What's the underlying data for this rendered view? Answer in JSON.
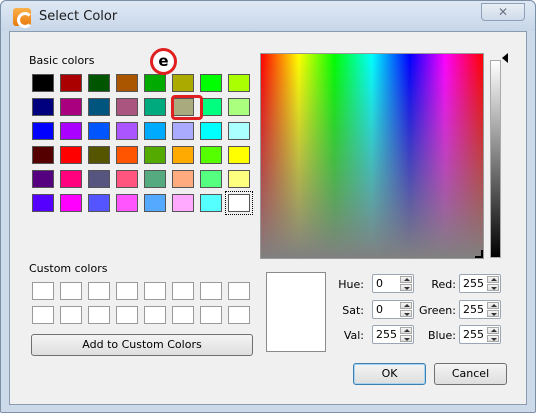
{
  "window": {
    "title": "Select Color",
    "close_glyph": "✕",
    "icon": "app-icon"
  },
  "annotation": {
    "badge_label": "e"
  },
  "basic": {
    "label": "Basic colors",
    "colors": [
      [
        "#000000",
        "#aa0000",
        "#005500",
        "#aa5500",
        "#00aa00",
        "#aaaa00",
        "#00ff00",
        "#aaff00"
      ],
      [
        "#00007f",
        "#aa007f",
        "#00557f",
        "#aa557f",
        "#00aa7f",
        "#aaaa7f",
        "#00ff7f",
        "#aaff7f"
      ],
      [
        "#0000ff",
        "#aa00ff",
        "#0055ff",
        "#aa55ff",
        "#00aaff",
        "#aaaaff",
        "#00ffff",
        "#aaffff"
      ],
      [
        "#550000",
        "#ff0000",
        "#555500",
        "#ff5500",
        "#55aa00",
        "#ffaa00",
        "#55ff00",
        "#ffff00"
      ],
      [
        "#55007f",
        "#ff007f",
        "#55557f",
        "#ff557f",
        "#55aa7f",
        "#ffaa7f",
        "#55ff7f",
        "#ffff7f"
      ],
      [
        "#5500ff",
        "#ff00ff",
        "#5555ff",
        "#ff55ff",
        "#55aaff",
        "#ffaaff",
        "#55ffff",
        "#ffffff"
      ]
    ]
  },
  "custom": {
    "label": "Custom colors",
    "add_button": "Add to Custom Colors"
  },
  "fields": {
    "hue": {
      "label": "Hue:",
      "value": "0"
    },
    "sat": {
      "label": "Sat:",
      "value": "0"
    },
    "val": {
      "label": "Val:",
      "value": "255"
    },
    "red": {
      "label": "Red:",
      "value": "255"
    },
    "green": {
      "label": "Green:",
      "value": "255"
    },
    "blue": {
      "label": "Blue:",
      "value": "255"
    }
  },
  "buttons": {
    "ok": "OK",
    "cancel": "Cancel"
  }
}
